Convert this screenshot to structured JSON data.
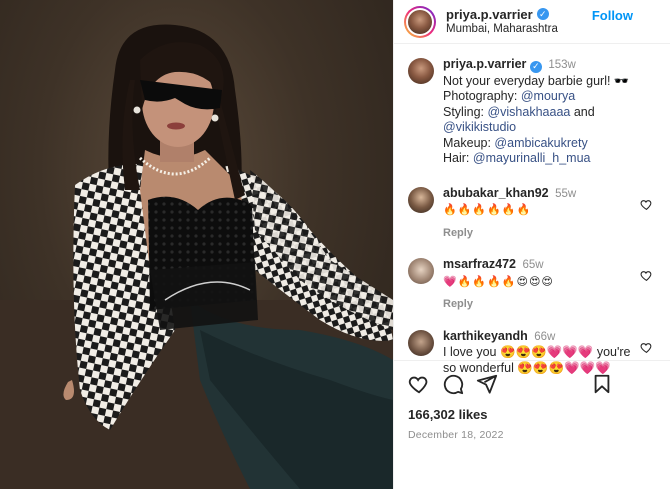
{
  "header": {
    "username": "priya.p.varrier",
    "location": "Mumbai, Maharashtra",
    "follow_label": "Follow"
  },
  "caption": {
    "username": "priya.p.varrier",
    "time": "153w",
    "line1": "Not your everyday barbie gurl! 🕶️",
    "photo_label": "Photography: ",
    "photo_handle": "@mourya",
    "styling_label": "Styling: ",
    "styling_handle1": "@vishakhaaaa",
    "styling_and": " and ",
    "styling_handle2": "@vikikistudio",
    "makeup_label": "Makeup: ",
    "makeup_handle": "@ambicakukrety",
    "hair_label": "Hair: ",
    "hair_handle": "@mayurinalli_h_mua"
  },
  "comments": [
    {
      "username": "abubakar_khan92",
      "time": "55w",
      "text": "🔥🔥🔥🔥🔥🔥",
      "reply": "Reply"
    },
    {
      "username": "msarfraz472",
      "time": "65w",
      "text": "💗🔥🔥🔥🔥😍😍😍",
      "reply": "Reply"
    },
    {
      "username": "karthikeyandh",
      "time": "66w",
      "text_a": "I love you 😍😍😍💗💗💗 you're",
      "text_b": "so wonderful 😍😍😍💗💗💗"
    }
  ],
  "likes": "166,302 likes",
  "date": "December 18, 2022",
  "icons": {
    "verified": "verified-badge",
    "like": "heart-icon",
    "comment": "comment-icon",
    "share": "share-icon",
    "save": "bookmark-icon"
  },
  "colors": {
    "accent": "#0095f6",
    "verified": "#3897f0",
    "muted": "#8e8e8e",
    "mention": "#385185"
  }
}
